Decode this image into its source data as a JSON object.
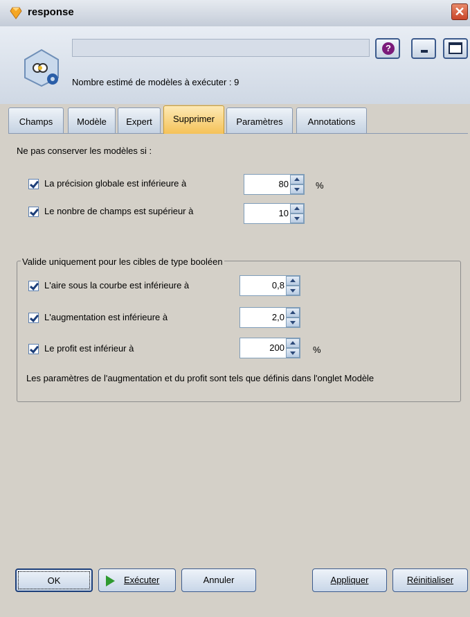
{
  "window": {
    "title": "response",
    "close_label": "✕"
  },
  "header": {
    "node_name_value": "",
    "model_count_text": "Nombre estimé de modèles à exécuter : 9",
    "help_label": "?"
  },
  "tabs": [
    {
      "label": "Champs",
      "active": false
    },
    {
      "label": "Modèle",
      "active": false
    },
    {
      "label": "Expert",
      "active": false
    },
    {
      "label": "Supprimer",
      "active": true
    },
    {
      "label": "Paramètres",
      "active": false
    },
    {
      "label": "Annotations",
      "active": false
    }
  ],
  "discard": {
    "heading": "Ne pas conserver les modèles si :",
    "precision": {
      "label": "La précision globale est inférieure à",
      "checked": true,
      "value": "80",
      "unit": "%"
    },
    "fields": {
      "label": "Le nonbre de champs est supérieur à",
      "checked": true,
      "value": "10"
    }
  },
  "boolean_group": {
    "title": "Valide uniquement pour les cibles de type booléen",
    "auc": {
      "label": "L'aire sous la courbe est inférieure à",
      "checked": true,
      "value": "0,8"
    },
    "lift": {
      "label": "L'augmentation est inférieure à",
      "checked": true,
      "value": "2,0"
    },
    "profit": {
      "label": "Le profit est inférieur à",
      "checked": true,
      "value": "200",
      "unit": "%"
    },
    "note": "Les paramètres de l'augmentation et du profit sont tels que définis dans l'onglet Modèle"
  },
  "footer": {
    "ok_label": "OK",
    "execute_label": "Exécuter",
    "cancel_label": "Annuler",
    "apply_label": "Appliquer",
    "reset_label": "Réinitialiser"
  },
  "colors": {
    "active_tab": "#f5c258",
    "accent_border": "#3b5a8c",
    "execute_icon": "#2f9a2f"
  }
}
